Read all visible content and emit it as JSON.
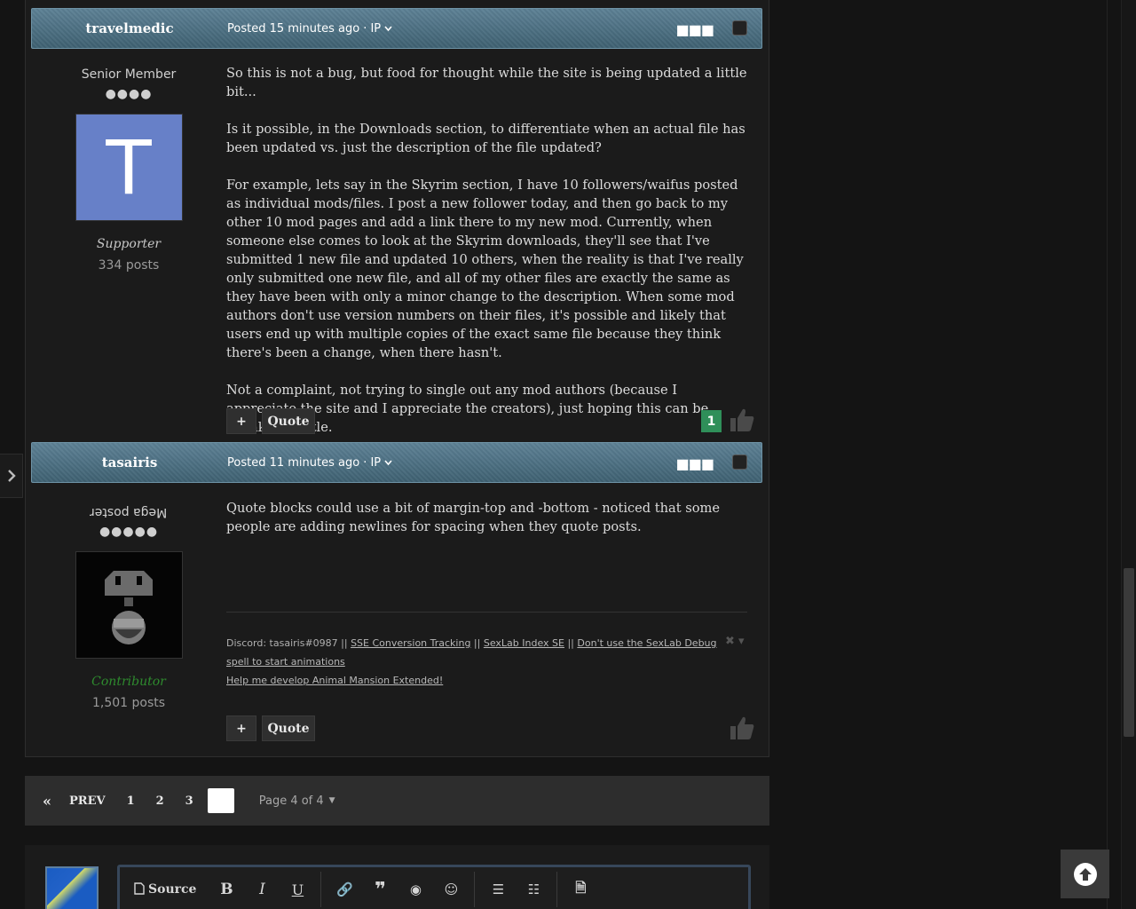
{
  "posts": [
    {
      "author": "travelmedic",
      "posted": "Posted 15 minutes ago",
      "ip": "· IP",
      "rank": "Senior Member",
      "pips": "●●●●",
      "avatar_letter": "T",
      "group": "Supporter",
      "post_count": "334 posts",
      "body": [
        "So this is not a bug, but food for thought while the site is being updated a little bit...",
        "Is it possible, in the Downloads section, to differentiate when an actual file has been updated vs. just the description of the file updated?",
        "For example, lets say in the Skyrim section, I have 10 followers/waifus posted as individual mods/files.  I post a new follower today, and then go back to my other 10 mod pages and add a link there to my new mod.  Currently, when someone else comes to look at the Skyrim downloads, they'll see that I've submitted 1 new file and updated 10 others, when the reality is that I've really only submitted one new file, and all of my other files are exactly the same as they have been with only a minor change to the description.  When some mod authors don't use version numbers on their files, it's possible and likely that users end up with multiple copies of the exact same file because they think there's been a change, when there hasn't.",
        "Not a complaint, not trying to single out any mod authors (because I appreciate the site and I appreciate the creators), just hoping this can be tweaked a little."
      ],
      "plus_label": "+",
      "quote_label": "Quote",
      "reputation": "1"
    },
    {
      "author": "tasairis",
      "posted": "Posted 11 minutes ago",
      "ip": "· IP",
      "rank": "Mega poster",
      "pips": "●●●●●",
      "group": "Contributor",
      "group_color": "#2e8b2e",
      "post_count": "1,501 posts",
      "body": [
        "Quote blocks could use a bit of margin-top and -bottom - noticed that some people are adding newlines for spacing when they quote posts."
      ],
      "signature": {
        "prefix": "Discord: tasairis#0987 || ",
        "link1": "SSE Conversion Tracking",
        "sep1": " || ",
        "link2": "SexLab Index SE",
        "sep2": " || ",
        "link3": "Don't use the SexLab Debug spell to start animations",
        "link4": "Help me develop Animal Mansion Extended!"
      },
      "plus_label": "+",
      "quote_label": "Quote"
    }
  ],
  "pagination": {
    "prev": "PREV",
    "pages": [
      "1",
      "2",
      "3"
    ],
    "page_of": "Page 4 of 4"
  },
  "editor": {
    "source_label": "Source",
    "bold": "B",
    "italic": "I",
    "underline": "U"
  }
}
